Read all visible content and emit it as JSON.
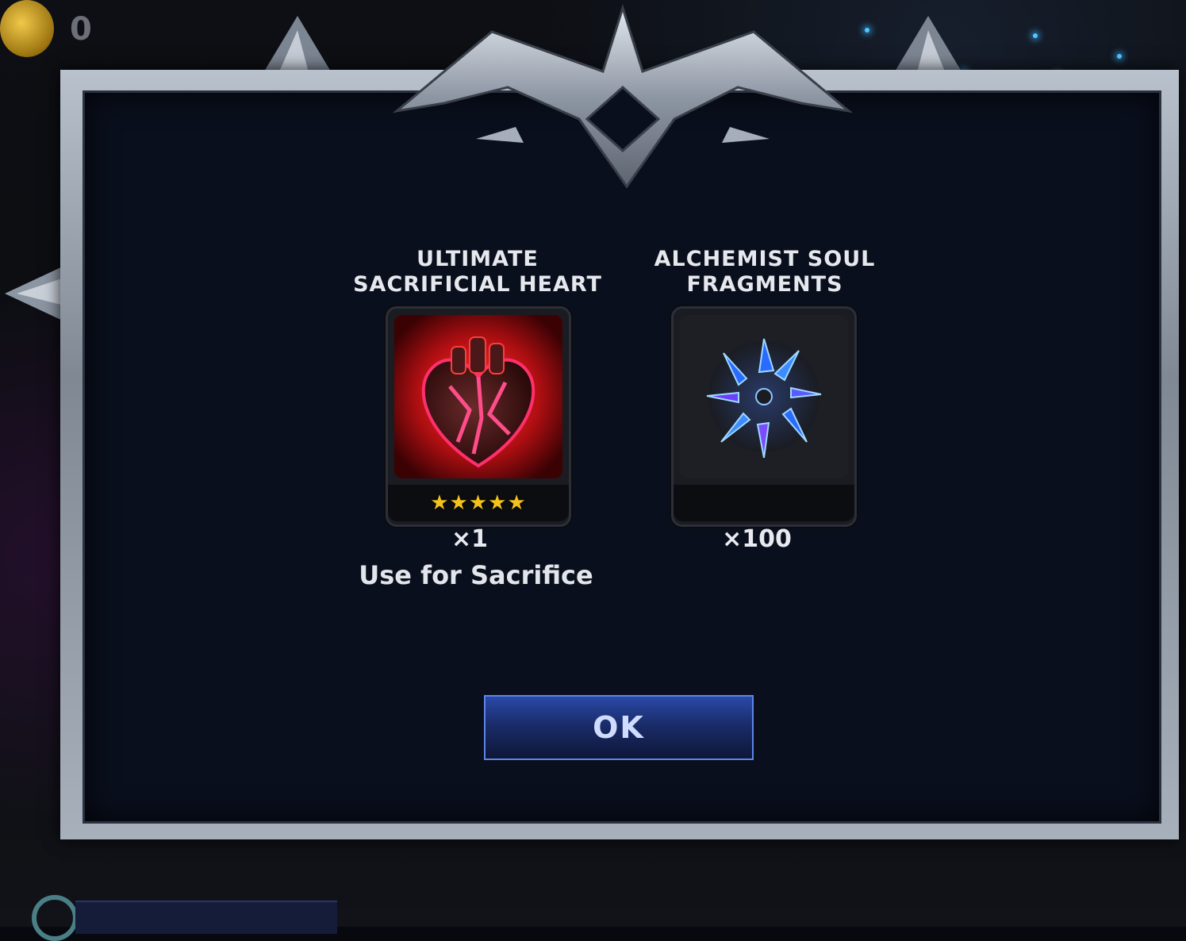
{
  "hud": {
    "coin_count": "0",
    "coin_icon": "gold-coin-icon"
  },
  "dialog": {
    "items": [
      {
        "title_line1": "ULTIMATE",
        "title_line2": "SACRIFICIAL HEART",
        "icon": "sacrificial-heart-icon",
        "stars": "★★★★★",
        "quantity": "×1",
        "note": "Use for Sacrifice"
      },
      {
        "title_line1": "ALCHEMIST SOUL",
        "title_line2": "FRAGMENTS",
        "icon": "soul-fragments-icon",
        "stars": "",
        "quantity": "×100"
      }
    ],
    "ok_label": "OK"
  },
  "colors": {
    "star": "#f4c21b",
    "button_border": "#5d84e8",
    "panel_bg": "#0a0f1d"
  }
}
